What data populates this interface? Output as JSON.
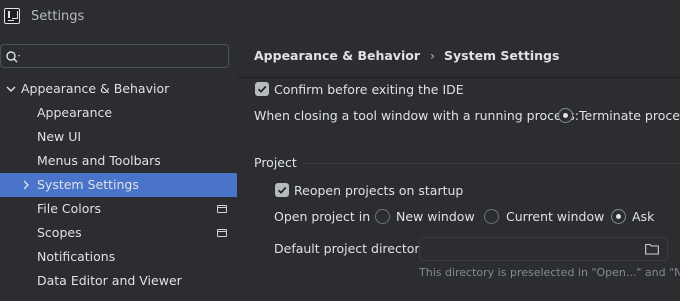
{
  "window": {
    "title": "Settings"
  },
  "search": {
    "placeholder": ""
  },
  "tree": {
    "items": [
      {
        "label": "Appearance & Behavior",
        "expanded": true
      },
      {
        "label": "Appearance"
      },
      {
        "label": "New UI"
      },
      {
        "label": "Menus and Toolbars"
      },
      {
        "label": "System Settings",
        "selected": true
      },
      {
        "label": "File Colors",
        "badge": "project-icon"
      },
      {
        "label": "Scopes",
        "badge": "project-icon"
      },
      {
        "label": "Notifications"
      },
      {
        "label": "Data Editor and Viewer"
      }
    ]
  },
  "breadcrumb": {
    "parent": "Appearance & Behavior",
    "separator": "›",
    "current": "System Settings"
  },
  "settings": {
    "confirm_exit": {
      "label": "Confirm before exiting the IDE",
      "checked": true
    },
    "closing_tool_window": {
      "label": "When closing a tool window with a running process:",
      "option": "Terminate process",
      "selected": true
    },
    "project_group": {
      "title": "Project"
    },
    "reopen_projects": {
      "label": "Reopen projects on startup",
      "checked": true
    },
    "open_project_in": {
      "label": "Open project in",
      "options": [
        "New window",
        "Current window",
        "Ask"
      ],
      "selected": "Ask"
    },
    "default_directory": {
      "label": "Default project directory:",
      "value": ""
    },
    "hint": "This directory is preselected in \"Open...\" and \"New"
  },
  "colors": {
    "selection": "#4a74c9",
    "background": "#2b2d30",
    "text": "#dfe1e5"
  }
}
